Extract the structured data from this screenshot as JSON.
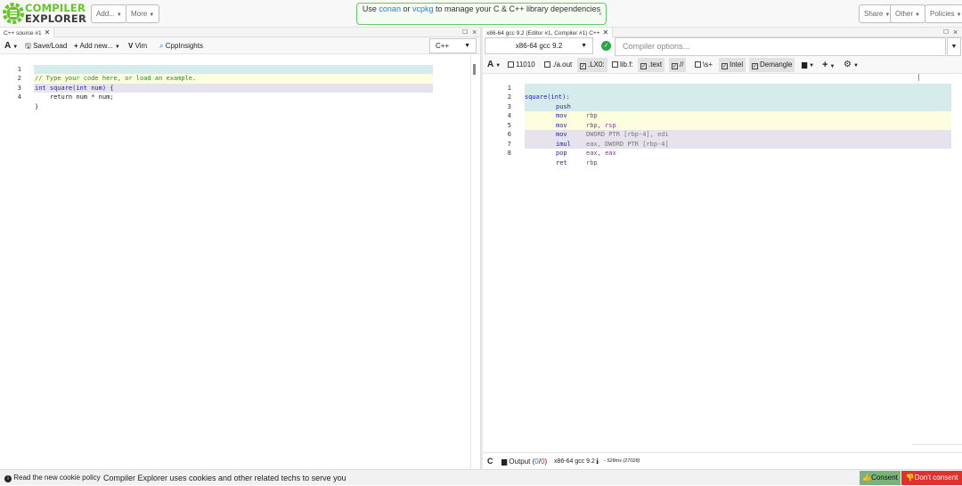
{
  "navbar": {
    "logo_line1": "COMPILER",
    "logo_line2": "EXPLORER",
    "add_label": "Add...",
    "more_label": "More",
    "share_label": "Share",
    "other_label": "Other",
    "policies_label": "Policies",
    "banner": {
      "pre": "Use ",
      "link1": "conan",
      "mid": " or ",
      "link2": "vcpkg",
      "post": " to manage your C & C++ library dependencies",
      "close": "×"
    }
  },
  "editor": {
    "tab_title": "C++ source #1",
    "tab_close": "✕",
    "toolbar": {
      "font_label": "A",
      "save_label": "Save/Load",
      "addnew_label": "Add new...",
      "vim_label": "Vim",
      "cppinsights_label": "CppInsights",
      "language": "C++"
    },
    "lines": [
      {
        "num": "1",
        "text": "// Type your code here, or load an example."
      },
      {
        "num": "2",
        "text": "int square(int num) {"
      },
      {
        "num": "3",
        "text": "    return num * num;"
      },
      {
        "num": "4",
        "text": "}"
      }
    ]
  },
  "compiler": {
    "tab_title": "x86-64 gcc 9.2 (Editor #1, Compiler #1) C++",
    "tab_close": "✕",
    "compiler_name": "x86-64 gcc 9.2",
    "options_placeholder": "Compiler options...",
    "filters": [
      {
        "label": "11010",
        "checked": false
      },
      {
        "label": "./a.out",
        "checked": false
      },
      {
        "label": ".LX0:",
        "checked": true
      },
      {
        "label": "lib.f:",
        "checked": false
      },
      {
        "label": ".text",
        "checked": true
      },
      {
        "label": "//",
        "checked": true
      },
      {
        "label": "\\s+",
        "checked": false
      },
      {
        "label": "Intel",
        "checked": true
      },
      {
        "label": "Demangle",
        "checked": true
      }
    ],
    "asm_lines": [
      {
        "num": "1",
        "label": "square(int):",
        "op": "",
        "args": ""
      },
      {
        "num": "2",
        "label": "",
        "op": "push",
        "args": "rbp"
      },
      {
        "num": "3",
        "label": "",
        "op": "mov",
        "args": "rbp, rsp"
      },
      {
        "num": "4",
        "label": "",
        "op": "mov",
        "args": "DWORD PTR [rbp-4], edi"
      },
      {
        "num": "5",
        "label": "",
        "op": "mov",
        "args": "eax, DWORD PTR [rbp-4]"
      },
      {
        "num": "6",
        "label": "",
        "op": "imul",
        "args": "eax, eax"
      },
      {
        "num": "7",
        "label": "",
        "op": "pop",
        "args": "rbp"
      },
      {
        "num": "8",
        "label": "",
        "op": "ret",
        "args": ""
      }
    ],
    "output": {
      "label": "Output (",
      "count_ok": "0",
      "slash": "/",
      "count_err": "0",
      "close": ")",
      "compiler": "x86-64 gcc 9.2",
      "timing": "- 528ms (27028)"
    }
  },
  "cookie": {
    "read_label": "Read the new cookie policy",
    "message": "Compiler Explorer uses cookies and other related techs to serve you",
    "consent_label": "Consent",
    "dont_label": "Don't consent"
  },
  "colors": {
    "accent_green": "#67c52a",
    "logo_text": "#3c3c3c",
    "line_hl_blue": "#d6ecec",
    "line_hl_yellow": "#fdfde0",
    "line_hl_purple": "#e6e3ee",
    "consent_green": "#79b37a",
    "dont_red": "#e0312f"
  }
}
